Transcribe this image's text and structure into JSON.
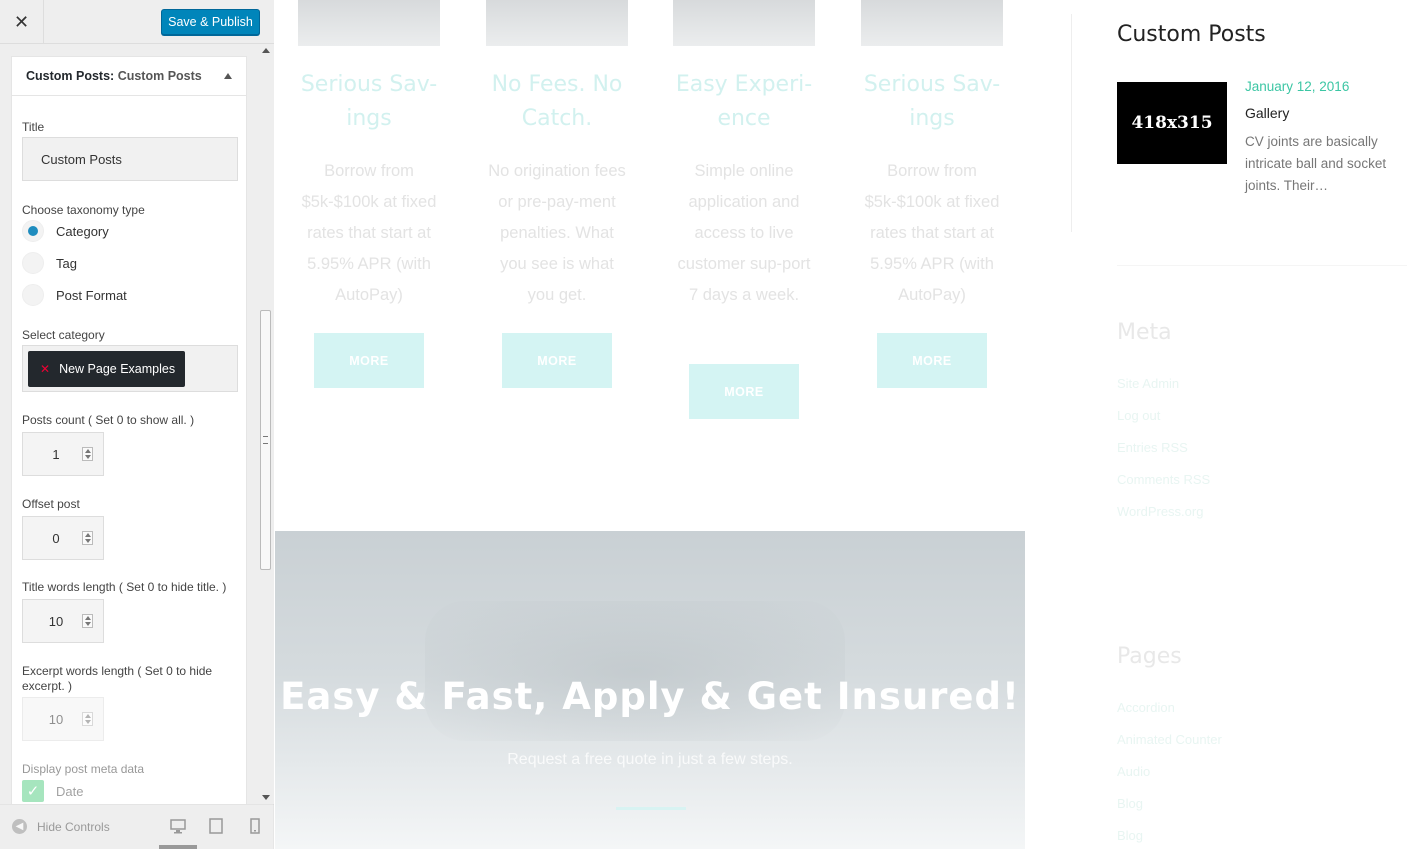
{
  "customizer": {
    "close_icon": "close-icon",
    "publish_label": "Save & Publish",
    "widget": {
      "prefix": "Custom Posts:",
      "name": "Custom Posts"
    },
    "title_label": "Title",
    "title_value": "Custom Posts",
    "taxonomy_label": "Choose taxonomy type",
    "taxonomy_options": [
      "Category",
      "Tag",
      "Post Format"
    ],
    "taxonomy_selected": "Category",
    "category_label": "Select category",
    "category_selected": "New Page Examples",
    "posts_count_label": "Posts count ( Set 0 to show all. )",
    "posts_count_value": "1",
    "offset_label": "Offset post",
    "offset_value": "0",
    "title_words_label": "Title words length ( Set 0 to hide title. )",
    "title_words_value": "10",
    "excerpt_words_label": "Excerpt words length ( Set 0 to hide excerpt. )",
    "excerpt_words_value": "10",
    "meta_label": "Display post meta data",
    "meta_date_label": "Date",
    "meta_date_checked": true,
    "hide_controls_label": "Hide Controls",
    "accent_color": "#0085ba"
  },
  "preview": {
    "features": [
      {
        "title": "Serious Sav-ings",
        "text": "Borrow from $5k-$100k at fixed rates that start at 5.95% APR (with AutoPay)",
        "button": "MORE"
      },
      {
        "title": "No Fees. No Catch.",
        "text": "No origination fees or pre-pay-ment penalties. What you see is what you get.",
        "button": "MORE"
      },
      {
        "title": "Easy Experi-ence",
        "text": "Simple online application and access to live customer sup-port 7 days a week.",
        "button": "MORE"
      },
      {
        "title": "Serious Sav-ings",
        "text": "Borrow from $5k-$100k at fixed rates that start at 5.95% APR (with AutoPay)",
        "button": "MORE"
      }
    ],
    "banner": {
      "heading": "Easy & Fast, Apply & Get Insured!",
      "subheading": "Request a free quote in just a few steps."
    },
    "sidebar": {
      "custom_posts_title": "Custom Posts",
      "post": {
        "thumb_text": "418x315",
        "date": "January 12, 2016",
        "title": "Gallery",
        "excerpt": "CV joints are basically intricate ball and socket joints. Their…"
      },
      "meta_title": "Meta",
      "meta_links": [
        "Site Admin",
        "Log out",
        "Entries RSS",
        "Comments RSS",
        "WordPress.org"
      ],
      "pages_title": "Pages",
      "pages_links": [
        "Accordion",
        "Animated Counter",
        "Audio",
        "Blog",
        "Blog"
      ]
    }
  }
}
